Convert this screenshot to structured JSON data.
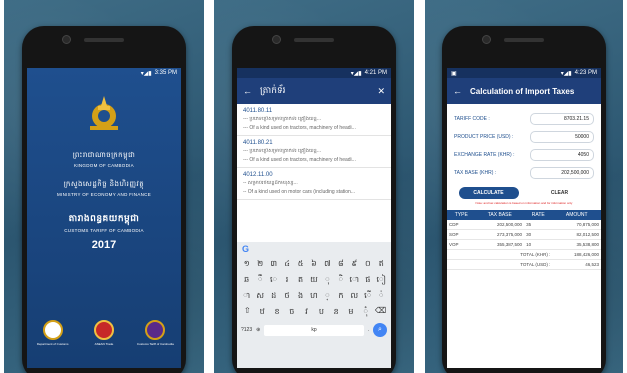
{
  "splash": {
    "status_time": "3:35 PM",
    "kh_title": "ព្រះរាជាណាចក្រកម្ពុជា",
    "en_title": "KINGDOM OF CAMBODIA",
    "kh_ministry": "ក្រសួងសេដ្ឋកិច្ច និងហិរញ្ញវត្ថុ",
    "en_ministry": "MINISTRY OF ECONOMY AND FINANCE",
    "kh_app": "តារាងពន្ធគយកម្ពុជា",
    "en_app": "CUSTOMS TARIFF OF CAMBODIA",
    "year": "2017",
    "logo_labels": [
      "Department of Customs",
      "ASEAN Trade",
      "Customs Tariff of Cambodia"
    ],
    "colors": {
      "bg": "#1f4f8e",
      "logo2": "#c62828",
      "logo3": "#5a2a8a"
    }
  },
  "search": {
    "status_time": "4:21 PM",
    "query": "ត្រាក់ទ័រ",
    "results": [
      {
        "code": "4011.80.11",
        "kh": "--- ប្រភេទប្រើសម្រាប់ត្រាក់ទ័រ គ្រឿងយន្ត...",
        "en": "--- Of a kind used on tractors, machinery of headi..."
      },
      {
        "code": "4011.80.21",
        "kh": "--- ប្រភេទប្រើសម្រាប់ត្រាក់ទ័រ គ្រឿងយន្ត...",
        "en": "--- Of a kind used on tractors, machinery of headi..."
      },
      {
        "code": "4012.11.00",
        "kh": "-- សម្រាប់រថយន្តដឹកមនុស្ស...",
        "en": "-- Of a kind used on motor cars (including station..."
      }
    ],
    "keyboard": {
      "rows": [
        [
          "១",
          "២",
          "៣",
          "៤",
          "៥",
          "៦",
          "៧",
          "៨",
          "៩",
          "០",
          "ឥ"
        ],
        [
          "ឆ",
          "ឹ",
          "េ",
          "រ",
          "ត",
          "យ",
          "ុ",
          "ិ",
          "ោ",
          "ផ",
          "ៀ"
        ],
        [
          "ា",
          "ស",
          "ដ",
          "ថ",
          "ង",
          "ហ",
          "្",
          "ក",
          "ល",
          "ើ",
          "់"
        ],
        [
          "ឋ",
          "ខ",
          "ច",
          "វ",
          "ប",
          "ន",
          "ម",
          "ុំ",
          "។",
          "៊"
        ]
      ],
      "num_label": "?123",
      "space_label": "kp"
    }
  },
  "calc": {
    "status_time": "4:23 PM",
    "title": "Calculation of Import Taxes",
    "fields": [
      {
        "label": "TARIFF CODE :",
        "value": "8703.21.15"
      },
      {
        "label": "PRODUCT PRICE (USD) :",
        "value": "50000"
      },
      {
        "label": "EXCHANGE RATE (KHR) :",
        "value": "4050"
      },
      {
        "label": "TAX BASE (KHR) :",
        "value": "202,500,000"
      }
    ],
    "calculate_label": "CALCULATE",
    "clear_label": "CLEAR",
    "note": "Note: and tax calculation is based on information and for information only",
    "table": {
      "headers": [
        "TYPE",
        "TAX BASE",
        "RATE",
        "AMOUNT"
      ],
      "rows": [
        [
          "CDP",
          "202,500,000",
          "35",
          "70,875,000"
        ],
        [
          "SOP",
          "273,375,000",
          "30",
          "82,012,500"
        ],
        [
          "VOP",
          "355,387,500",
          "10",
          "35,538,800"
        ]
      ],
      "total_khr_label": "TOTAL (KHR) :",
      "total_khr": "188,426,000",
      "total_usd_label": "TOTAL (USD) :",
      "total_usd": "46,523"
    }
  }
}
